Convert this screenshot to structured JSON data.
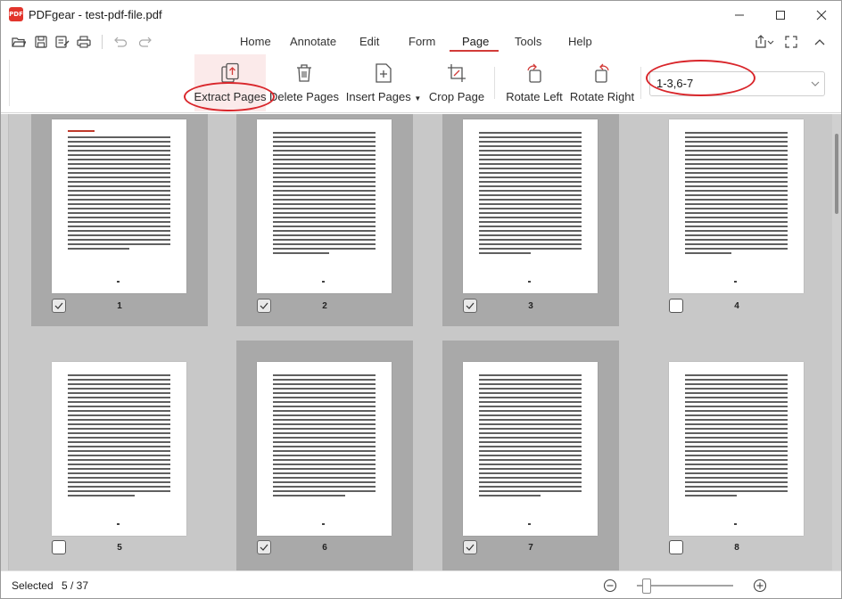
{
  "window": {
    "app_logo_text": "PDF",
    "title": "PDFgear - test-pdf-file.pdf"
  },
  "menu": {
    "tabs": [
      {
        "label": "Home"
      },
      {
        "label": "Annotate"
      },
      {
        "label": "Edit"
      },
      {
        "label": "Form"
      },
      {
        "label": "Page",
        "active": true
      },
      {
        "label": "Tools"
      },
      {
        "label": "Help"
      }
    ]
  },
  "ribbon": {
    "tools": [
      {
        "label": "Extract Pages",
        "icon": "extract-pages-icon",
        "selected": true
      },
      {
        "label": "Delete Pages",
        "icon": "trash-icon"
      },
      {
        "label": "Insert Pages",
        "icon": "insert-page-icon",
        "has_dropdown": true
      },
      {
        "label": "Crop Page",
        "icon": "crop-icon"
      },
      {
        "label": "Rotate Left",
        "icon": "rotate-left-icon"
      },
      {
        "label": "Rotate Right",
        "icon": "rotate-right-icon"
      }
    ],
    "page_range_value": "1-3,6-7"
  },
  "pages": [
    {
      "number": "1",
      "checked": true
    },
    {
      "number": "2",
      "checked": true
    },
    {
      "number": "3",
      "checked": true
    },
    {
      "number": "4",
      "checked": false
    },
    {
      "number": "5",
      "checked": false
    },
    {
      "number": "6",
      "checked": true
    },
    {
      "number": "7",
      "checked": true
    },
    {
      "number": "8",
      "checked": false
    }
  ],
  "status": {
    "selected_label": "Selected",
    "selected_count": "5 / 37",
    "zoom_level": 0.1
  },
  "colors": {
    "accent": "#d23b38",
    "annotation": "#d9262b",
    "selected_card": "#a9a9a9",
    "canvas": "#c8c8c8"
  }
}
